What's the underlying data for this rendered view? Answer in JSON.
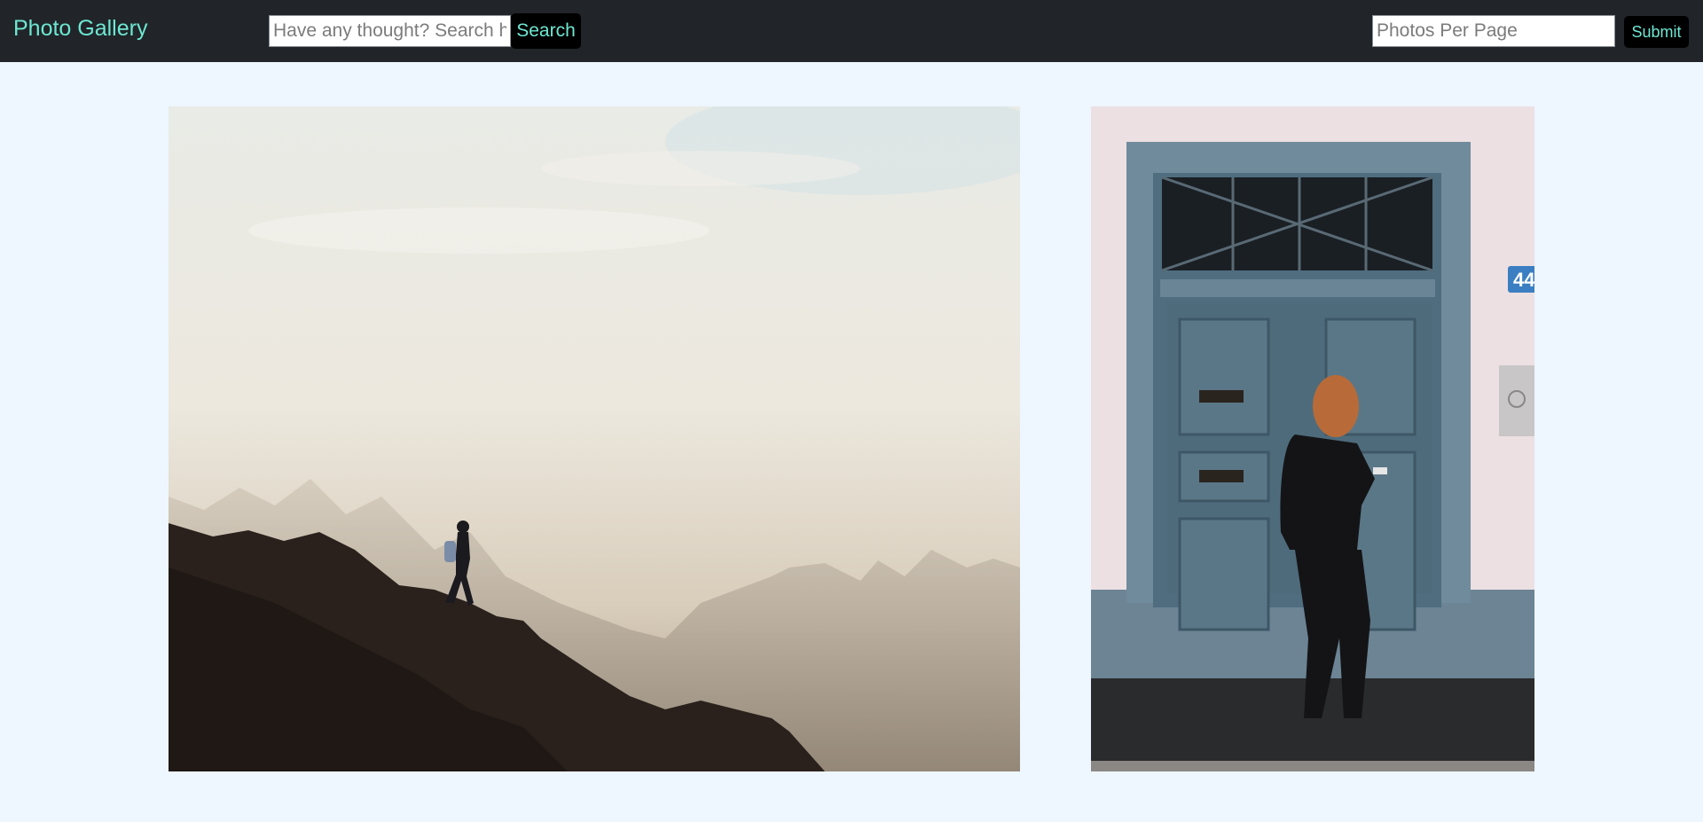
{
  "navbar": {
    "brand": "Photo Gallery",
    "search_placeholder": "Have any thought? Search here",
    "search_label": "Search",
    "per_page_placeholder": "Photos Per Page",
    "submit_label": "Submit"
  },
  "gallery": {
    "photos": [
      {
        "subject": "hiker-on-misty-mountain-ridge"
      },
      {
        "subject": "woman-walking-past-blue-door",
        "door_number": "44"
      }
    ]
  },
  "colors": {
    "navbar_bg": "#212529",
    "accent": "#6ee7d2",
    "page_bg": "#eef6ff"
  }
}
